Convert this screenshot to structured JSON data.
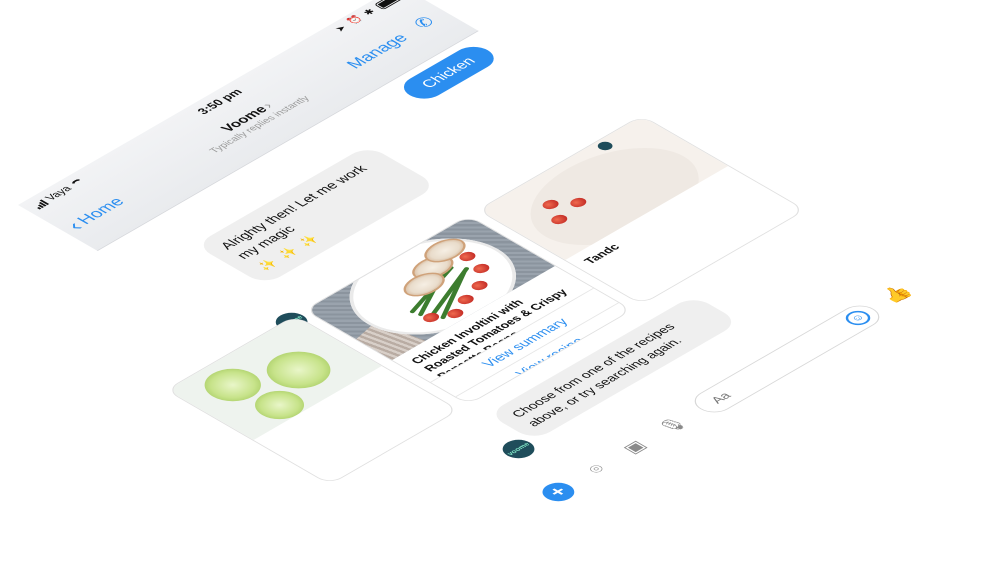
{
  "status_bar": {
    "carrier": "Vaya",
    "time": "3:50 pm",
    "signal_bars": 4,
    "battery_level": 0.85
  },
  "header": {
    "back_label": "Home",
    "title": "Voome",
    "subtitle": "Typically replies instantly",
    "manage_label": "Manage",
    "call_icon": "phone-icon"
  },
  "messages": {
    "user_message": "Chicken",
    "bot_message": "Alrighty then! Let me work my magic",
    "bot_sparkles": "✨ ✨ ✨",
    "avatar_label": "voome",
    "followup_message": "Choose from one of the recipes above, or try searching again."
  },
  "carousel": {
    "main_card": {
      "title": "Chicken Involtini with Roasted Tomatoes & Crispy Pancetta Beans",
      "summary_button": "View summary",
      "recipe_button": "View recipe"
    },
    "next_card": {
      "title": "Tandc"
    }
  },
  "composer": {
    "placeholder": "Aa",
    "add_icon": "+",
    "camera_icon": "camera-icon",
    "image_icon": "image-icon",
    "mic_icon": "microphone-icon",
    "emoji_icon": "emoji-icon",
    "like_icon": "thumbs-up-icon"
  },
  "colors": {
    "accent": "#2b8ef0",
    "bubble_gray": "#efefef",
    "avatar_bg": "#1f4d5b",
    "avatar_text": "#7fe3c5"
  }
}
